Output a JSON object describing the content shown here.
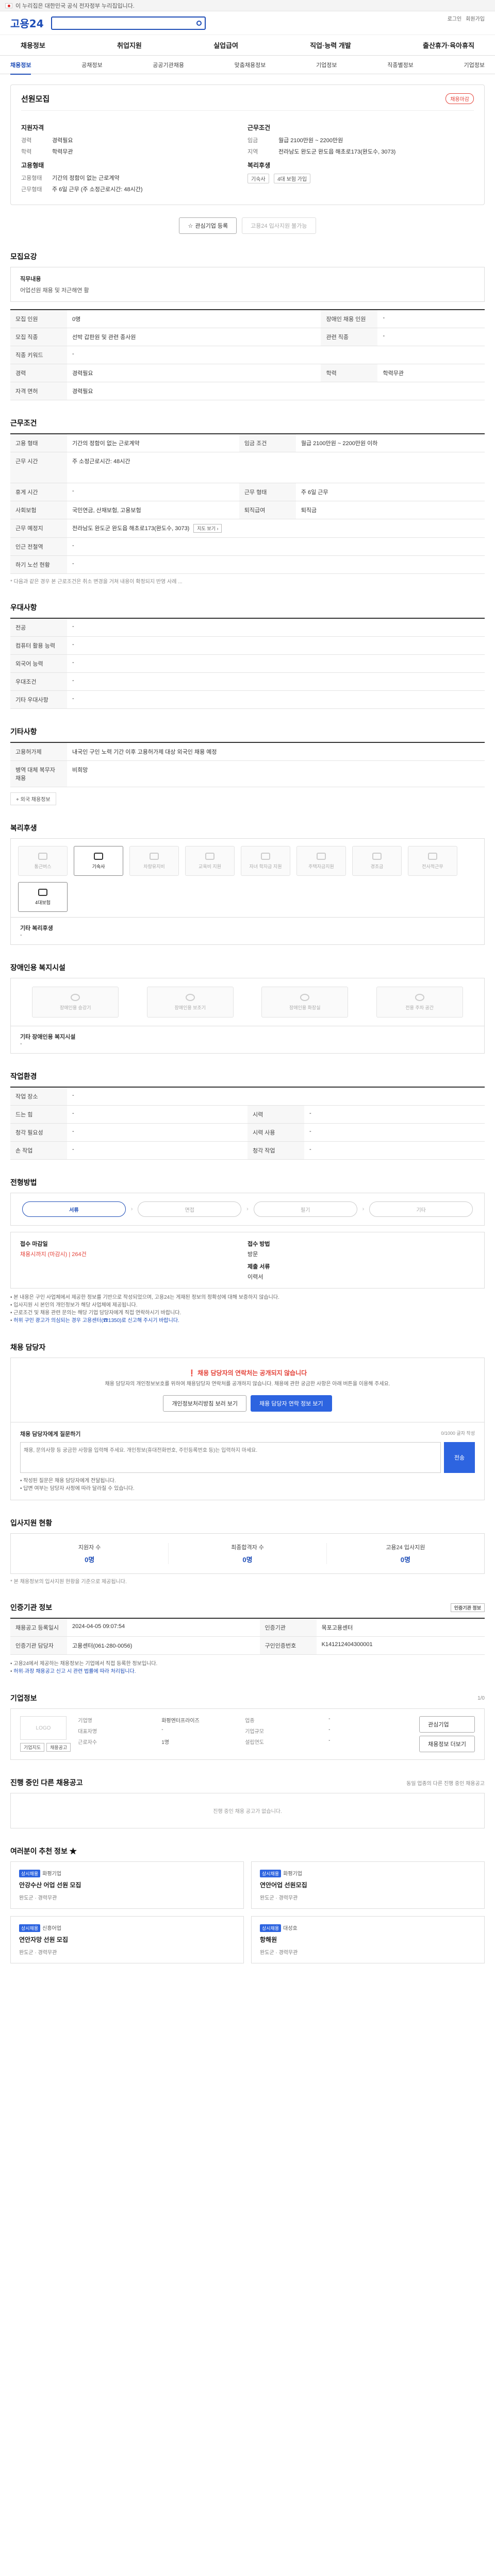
{
  "gov_banner": "이 누리집은 대한민국 공식 전자정부 누리집입니다.",
  "header": {
    "logo": "고용24",
    "search_value": "",
    "toplinks": [
      "로그인",
      "회원가입"
    ],
    "gnb": [
      "채용정보",
      "취업지원",
      "실업급여",
      "직업·능력 개발",
      "출산휴가·육아휴직"
    ],
    "lnb": [
      "채용정보",
      "공채정보",
      "공공기관채용",
      "맞춤채용정보",
      "기업정보",
      "직종별정보",
      "기업정보"
    ],
    "lnb_active": 0
  },
  "summary": {
    "title": "선원모집",
    "status": "채용마감",
    "left": {
      "heading_1": "지원자격",
      "rows_1": [
        {
          "k": "경력",
          "v": "경력필요"
        },
        {
          "k": "학력",
          "v": "학력무관"
        }
      ],
      "heading_2": "고용형태",
      "rows_2": [
        {
          "k": "고용형태",
          "v": "기간의 정함이 없는 근로계약"
        },
        {
          "k": "근무형태",
          "v": "주 6일 근무 (주 소정근로시간: 48시간)"
        }
      ]
    },
    "right": {
      "heading_1": "근무조건",
      "rows_1": [
        {
          "k": "임금",
          "v": "월급 2100만원 ~ 2200만원"
        },
        {
          "k": "지역",
          "v": "전라남도 완도군 완도읍 해초로173(완도수, 3073)"
        }
      ],
      "heading_2": "복리후생",
      "chips": [
        "기숙사",
        "4대 보험 가입"
      ]
    },
    "btn_interest": "관심기업 등록",
    "btn_apply": "고용24 입사지원 불가능"
  },
  "sections": {
    "recruit_title": "모집요강",
    "job_content_label": "직무내용",
    "job_content": "어업선원 채용 및 저근해연 활",
    "recruit_rows": [
      [
        {
          "k": "모집 인원",
          "v": "0명"
        },
        {
          "k": "장애인 채용 인원",
          "v": "-"
        }
      ],
      [
        {
          "k": "모집 직종",
          "v": "선박 갑판원 및 관련 종사원"
        },
        {
          "k": "관련 직종",
          "v": "-"
        }
      ],
      [
        {
          "k": "직종 키워드",
          "v": "-"
        }
      ],
      [
        {
          "k": "경력",
          "v": "경력필요"
        },
        {
          "k": "학력",
          "v": "학력무관"
        }
      ],
      [
        {
          "k": "자격 면허",
          "v": "경력필요"
        }
      ]
    ],
    "work_title": "근무조건",
    "work_rows": [
      [
        {
          "k": "고용 형태",
          "v": "기간의 정함이 없는 근로계약"
        },
        {
          "k": "임금 조건",
          "v": "월급 2100만원 ~ 2200만원 이하"
        }
      ],
      [
        {
          "k": "근무 시간",
          "v": "주 소정근로시간: 48시간"
        }
      ],
      [
        {
          "k": "휴게 시간",
          "v": "-"
        },
        {
          "k": "근무 형태",
          "v": "주 6일 근무"
        }
      ],
      [
        {
          "k": "사회보험",
          "v": "국민연금, 산재보험, 고용보험"
        },
        {
          "k": "퇴직급여",
          "v": "퇴직금"
        }
      ],
      [
        {
          "k": "근무 예정지",
          "v": "전라남도 완도군 완도읍 해초로173(완도수, 3073)"
        }
      ],
      [
        {
          "k": "인근 전철역",
          "v": "-"
        }
      ],
      [
        {
          "k": "하기 노선 현황",
          "v": "-"
        }
      ]
    ],
    "work_note": "* 다음과 같은 경우 본 근로조건은 취소 변경을 거쳐 내용이 확정되지 반영 사례 ...",
    "pref_title": "우대사항",
    "pref_rows": [
      {
        "k": "전공",
        "v": "-"
      },
      {
        "k": "컴퓨터 활용 능력",
        "v": "-"
      },
      {
        "k": "외국어 능력",
        "v": "-"
      },
      {
        "k": "우대조건",
        "v": "-"
      },
      {
        "k": "기타 우대사항",
        "v": "-"
      }
    ],
    "etc_title": "기타사항",
    "etc_rows": [
      {
        "k": "고용허가제",
        "v": "내국인 구인 노력 기간 이후 고용허가제 대상 외국인 채용 예정"
      },
      {
        "k": "병역 대체 복무자 채용",
        "v": "비희망"
      }
    ],
    "etc_more": "+ 외국 채용정보",
    "welfare_title": "복리후생",
    "welfare_items": [
      {
        "label": "통근버스",
        "on": false
      },
      {
        "label": "기숙사",
        "on": true
      },
      {
        "label": "차량유지비",
        "on": false
      },
      {
        "label": "교육비 지원",
        "on": false
      },
      {
        "label": "자녀 학자금 지원",
        "on": false
      },
      {
        "label": "주택자금지원",
        "on": false
      },
      {
        "label": "경조금",
        "on": false
      },
      {
        "label": "전사적근무",
        "on": false
      },
      {
        "label": "4대보험",
        "on": true
      }
    ],
    "welfare_other_label": "기타 복리후생",
    "welfare_other": "-",
    "disability_title": "장애인용 복지시설",
    "disability_items": [
      "장애인용 승강기",
      "장애인용 보조기",
      "장애인용 화장실",
      "전용 주차 공간"
    ],
    "disability_other_label": "기타 장애인용 복지시설",
    "disability_other": "-",
    "env_title": "작업환경",
    "env_rows": [
      [
        {
          "k": "작업 장소",
          "v": "-"
        }
      ],
      [
        {
          "k": "드는 힘",
          "v": "-"
        },
        {
          "k": "시력",
          "v": "-"
        }
      ],
      [
        {
          "k": "청각 필요성",
          "v": "-"
        },
        {
          "k": "시력 사용",
          "v": "-"
        }
      ],
      [
        {
          "k": "손 작업",
          "v": "-"
        },
        {
          "k": "청각 작업",
          "v": "-"
        }
      ]
    ],
    "process_title": "전형방법",
    "process_steps": [
      {
        "label": "서류",
        "on": true
      },
      {
        "label": "면접",
        "on": false
      },
      {
        "label": "필기",
        "on": false
      },
      {
        "label": "기타",
        "on": false
      }
    ],
    "apply_period_label": "접수 마감일",
    "apply_period": "채용시까지 (마감시) | 264건",
    "apply_method_label": "접수 방법",
    "apply_method": "방문",
    "apply_docs_label": "제출 서류",
    "apply_docs": "이력서",
    "apply_bullets": [
      "본 내용은 구인 사업체에서 제공한 정보를 기반으로 작성되었으며, 고용24는 게재된 정보의 정확성에 대해 보증하지 않습니다.",
      "입사지원 시 본인의 개인정보가 해당 사업체에 제공됩니다.",
      "근로조건 및 채용 관련 문의는 해당 기업 담당자에게 직접 연락하시기 바랍니다.",
      "허위 구인 광고가 의심되는 경우 고용센터(☎1350)로 신고해 주시기 바랍니다."
    ],
    "contact_title": "채용 담당자",
    "contact_warn": "❗ 채용 담당자의 연락처는 공개되지 않습니다",
    "contact_desc": "채용 담당자의 개인정보보호를 위하여 채용담당자 연락처를 공개하지 않습니다. 채용에 관한 궁금한 사항은 아래 버튼을 이용해 주세요.",
    "contact_btn_1": "개인정보처리방침 보러 보기",
    "contact_btn_2": "채용 담당자 연락 정보 보기",
    "inquiry_title": "채용 담당자에게 질문하기",
    "inquiry_limit": "0/1000 글자 작성",
    "inquiry_placeholder": "채용, 문의사항 등 궁금한 사항을 입력해 주세요. 개인정보(휴대전화번호, 주민등록번호 등)는 입력하지 마세요.",
    "inquiry_send": "전송",
    "inquiry_bullets": [
      "작성된 질문은 채용 담당자에게 전달됩니다.",
      "답변 여부는 담당자 사정에 따라 달라질 수 있습니다."
    ],
    "status_title": "입사지원 현황",
    "status_cols": [
      {
        "label": "지원자 수",
        "value": "0명"
      },
      {
        "label": "최종합격자 수",
        "value": "0명"
      },
      {
        "label": "고용24 입사지원",
        "value": "0명"
      }
    ],
    "status_note": "* 본 채용정보의 입사지원 현황을 기준으로 제공됩니다.",
    "notice_title": "인증기관 정보",
    "notice_rows": [
      [
        {
          "k": "채용공고 등록일시",
          "v": "2024-04-05 09:07:54"
        },
        {
          "k": "인증기관",
          "v": "목포고용센터"
        }
      ],
      [
        {
          "k": "인증기관 담당자",
          "v": "고용센터(061-280-0056)"
        },
        {
          "k": "구인인증번호",
          "v": "K141212404300001"
        }
      ]
    ],
    "notice_btn": "인증기관 정보",
    "notice_bullets": [
      "고용24에서 제공하는 채용정보는 기업에서 직접 등록한 정보입니다.",
      "허위·과장 채용공고 신고 시 관련 법률에 따라 처리됩니다."
    ],
    "company_title": "기업정보",
    "company_page": "1/0",
    "company_logo": "LOGO",
    "company_rows": [
      [
        {
          "k": "기업명",
          "v": "화평엔터프라이즈"
        },
        {
          "k": "업종",
          "v": "-"
        }
      ],
      [
        {
          "k": "대표자명",
          "v": "-"
        },
        {
          "k": "기업규모",
          "v": "-"
        }
      ],
      [
        {
          "k": "근로자수",
          "v": "1명"
        },
        {
          "k": "설립연도",
          "v": "-"
        }
      ]
    ],
    "company_btn_1": "관심기업",
    "company_btn_2": "채용정보 더보기",
    "company_small_1": "기업지도",
    "company_small_2": "채용공고",
    "others_title": "진행 중인 다른 채용공고",
    "others_right": "동일 업종의 다른 진행 중인 채용공고",
    "others_empty": "진행 중인 채용 공고가 없습니다.",
    "rec_title": "여러분이 추천 정보 ★",
    "rec_cards": [
      {
        "tag": "상시채용",
        "co": "화평기업",
        "title": "안강수산 어업 선원 모집",
        "meta": "완도군 · 경력무관"
      },
      {
        "tag": "상시채용",
        "co": "화평기업",
        "title": "연안어업 선원모집",
        "meta": "완도군 · 경력무관"
      },
      {
        "tag": "상시채용",
        "co": "신흥어업",
        "title": "연안자망 선원 모집",
        "meta": "완도군 · 경력무관"
      },
      {
        "tag": "상시채용",
        "co": "대성호",
        "title": "항해원",
        "meta": "완도군 · 경력무관"
      }
    ]
  }
}
